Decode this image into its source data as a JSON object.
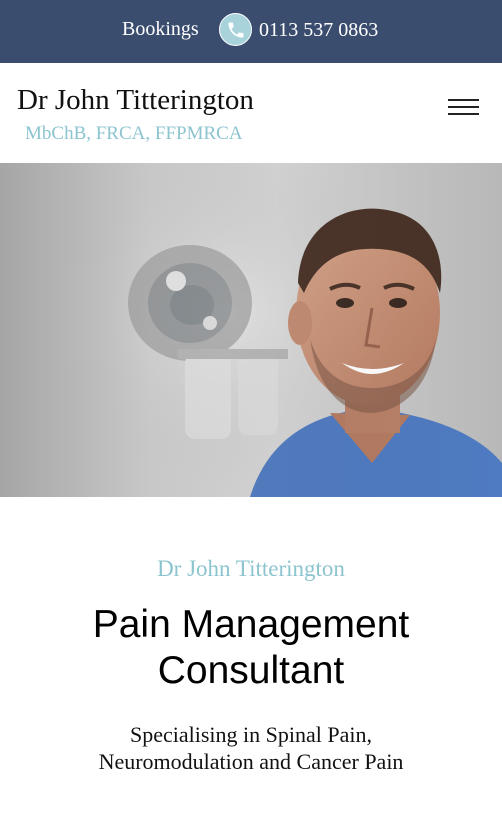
{
  "topbar": {
    "bookings_label": "Bookings",
    "phone_icon": "phone-icon",
    "phone_number": "0113 537 0863"
  },
  "header": {
    "site_name": "Dr John Titterington",
    "qualifications": "MbChB, FRCA, FFPMRCA",
    "menu_icon": "hamburger-menu-icon"
  },
  "hero": {
    "image": "portrait-photo"
  },
  "content": {
    "eyebrow": "Dr John Titterington",
    "headline_line1": "Pain Management",
    "headline_line2": "Consultant",
    "tagline": "Specialising in Spinal Pain, Neuromodulation and Cancer Pain"
  },
  "colors": {
    "topbar_bg": "#3b4d6e",
    "accent": "#8cc4cf",
    "scrubs": "#4f7bc2"
  }
}
